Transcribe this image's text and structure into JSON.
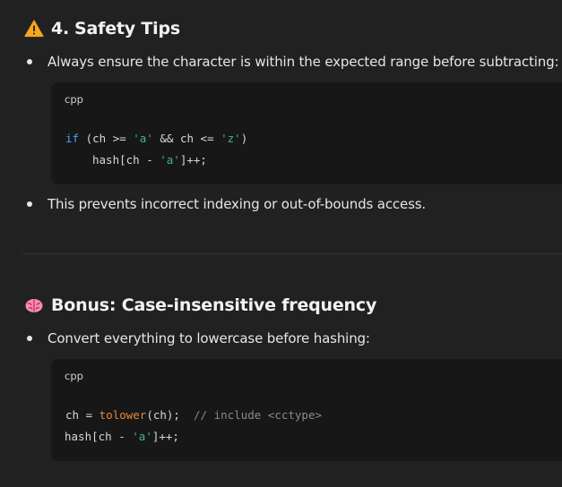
{
  "section1": {
    "heading_number": "4.",
    "heading_title": "Safety Tips",
    "icon": "warning-icon",
    "bullet1": "Always ensure the character is within the expected range before subtracting:",
    "code": {
      "lang": "cpp",
      "line1": {
        "kw_if": "if",
        "t1": " (ch >= ",
        "s1": "'a'",
        "t2": " && ch <= ",
        "s2": "'z'",
        "t3": ")"
      },
      "line2": {
        "t1": "hash[ch - ",
        "s1": "'a'",
        "t2": "]++;"
      }
    },
    "bullet2": "This prevents incorrect indexing or out-of-bounds access."
  },
  "section2": {
    "icon": "brain-icon",
    "heading_title": "Bonus: Case-insensitive frequency",
    "bullet1": "Convert everything to lowercase before hashing:",
    "code": {
      "lang": "cpp",
      "line1": {
        "t1": "ch = ",
        "fn": "tolower",
        "t2": "(ch);  ",
        "comment": "// include <cctype>"
      },
      "line2": {
        "t1": "hash[ch - ",
        "s1": "'a'",
        "t2": "]++;"
      }
    }
  },
  "colors": {
    "background": "#212121",
    "code_background": "#171717",
    "keyword": "#4aa3f0",
    "string": "#45b38f",
    "function": "#e8883a",
    "comment": "#8a8a8a",
    "warning": "#f5a623",
    "brain": "#f48fb1"
  }
}
